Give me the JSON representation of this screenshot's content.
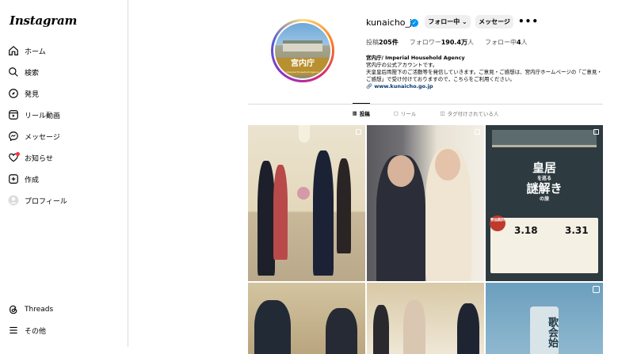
{
  "app": {
    "logo": "Instagram"
  },
  "sidebar": {
    "items": [
      {
        "label": "ホーム",
        "icon": "home-icon"
      },
      {
        "label": "検索",
        "icon": "search-icon"
      },
      {
        "label": "発見",
        "icon": "compass-icon"
      },
      {
        "label": "リール動画",
        "icon": "reels-icon"
      },
      {
        "label": "メッセージ",
        "icon": "messenger-icon"
      },
      {
        "label": "お知らせ",
        "icon": "heart-icon"
      },
      {
        "label": "作成",
        "icon": "plus-square-icon"
      },
      {
        "label": "プロフィール",
        "icon": "profile-avatar-icon"
      }
    ],
    "bottom": [
      {
        "label": "Threads",
        "icon": "threads-icon"
      },
      {
        "label": "その他",
        "icon": "menu-icon"
      }
    ]
  },
  "profile": {
    "username": "kunaicho_jp",
    "avatar_text": "宮内庁",
    "avatar_subtext": "Imperial Household Agency",
    "follow_button": "フォロー中 ⌄",
    "message_button": "メッセージ",
    "more": "•••",
    "stats": {
      "posts_label": "投稿",
      "posts_value": "205件",
      "followers_label": "フォロワー",
      "followers_value": "190.4万",
      "followers_unit": "人",
      "following_label": "フォロー中",
      "following_value": "4",
      "following_unit": "人"
    },
    "bio": {
      "name": "宮内庁/ Imperial Household Agency",
      "line1": "宮内庁の公式アカウントです。",
      "line2": "天皇皇后両陛下のご活動等を発信していきます。ご意見・ご感想は、宮内庁ホームページの「ご意見・ご感想」で受け付けておりますので，こちらをご利用ください。",
      "link": "www.kunaicho.go.jp"
    }
  },
  "tabs": [
    {
      "label": "投稿",
      "icon": "grid-icon",
      "active": true
    },
    {
      "label": "リール",
      "icon": "reels-icon",
      "active": false
    },
    {
      "label": "タグ付けされている人",
      "icon": "tag-icon",
      "active": false
    }
  ],
  "posts": {
    "p3_title_1": "皇居",
    "p3_title_small": "を巡る",
    "p3_title_2": "謎解き",
    "p3_title_small2": "の旅",
    "p3_badge": "参加無料",
    "p3_date1": "3.18",
    "p3_date2": "3.31",
    "p6_text": "歌会始"
  }
}
